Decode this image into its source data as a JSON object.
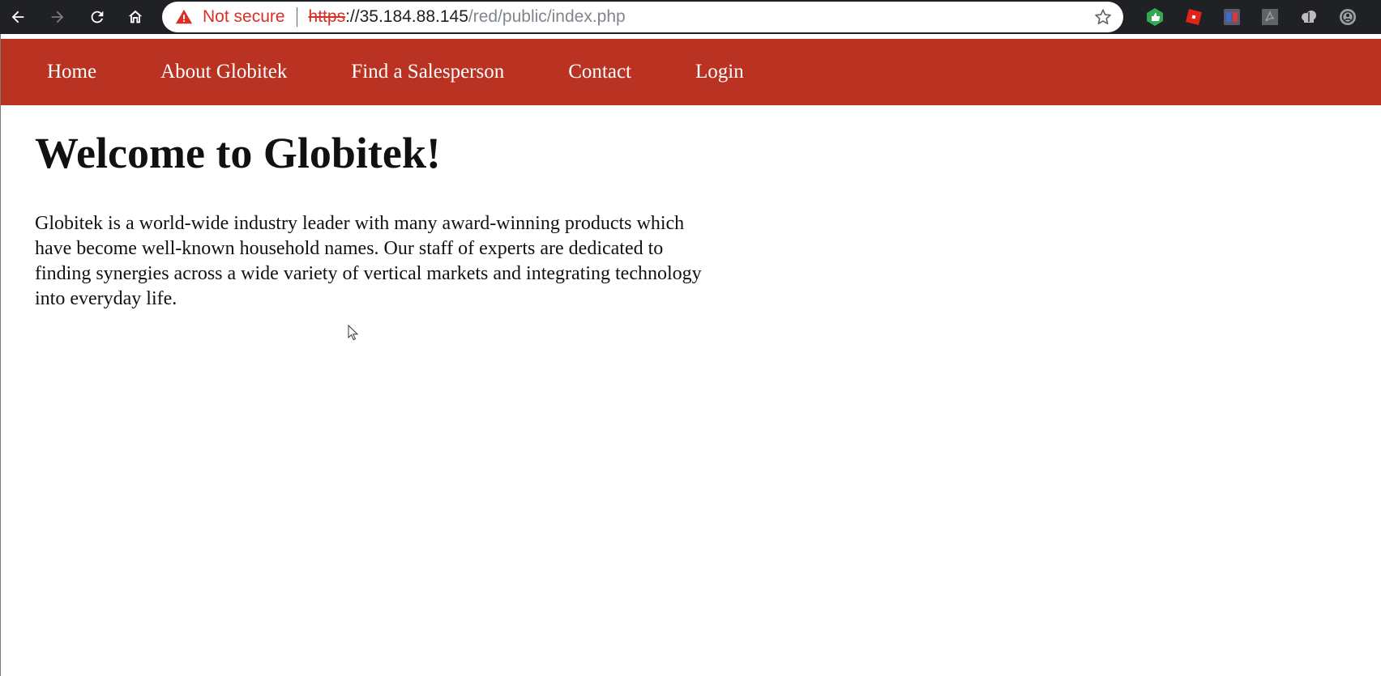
{
  "browser": {
    "security_label": "Not secure",
    "url_scheme": "https",
    "url_host": "://35.184.88.145",
    "url_path": "/red/public/index.php",
    "icons": [
      "back-icon",
      "forward-icon",
      "reload-icon",
      "home-icon",
      "warning-icon",
      "bookmark-star-icon"
    ],
    "extensions": [
      "thumbs-up-extension-icon",
      "roblox-extension-icon",
      "extension-icon",
      "pdf-extension-icon",
      "cloud-extension-icon",
      "profile-icon"
    ]
  },
  "site_nav": {
    "background": "#b93222",
    "items": [
      {
        "label": "Home"
      },
      {
        "label": "About Globitek"
      },
      {
        "label": "Find a Salesperson"
      },
      {
        "label": "Contact"
      },
      {
        "label": "Login"
      }
    ]
  },
  "main": {
    "heading": "Welcome to Globitek!",
    "body": "Globitek is a world-wide industry leader with many award-winning products which have become well-known household names. Our staff of experts are dedicated to finding synergies across a wide variety of vertical markets and integrating technology into everyday life."
  }
}
